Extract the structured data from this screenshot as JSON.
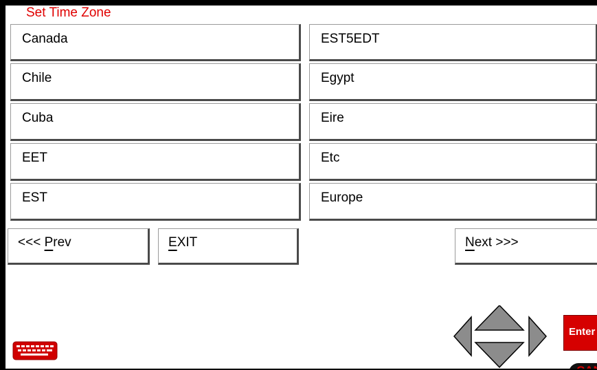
{
  "title": "Set Time Zone",
  "zones_left": [
    "Canada",
    "Chile",
    "Cuba",
    "EET",
    "EST"
  ],
  "zones_right": [
    "EST5EDT",
    "Egypt",
    "Eire",
    "Etc",
    "Europe"
  ],
  "nav": {
    "prev_prefix": "<<< ",
    "prev_hot": "P",
    "prev_rest": "rev",
    "exit_hot": "E",
    "exit_rest": "XIT",
    "next_hot": "N",
    "next_rest": "ext >>>"
  },
  "enter_label": "Enter",
  "cancel_label": "CAN",
  "colors": {
    "title": "#e00000",
    "enter_bg": "#d60000",
    "arrow_fill": "#8c8c8c"
  },
  "icons": [
    "keyboard-icon",
    "arrow-left-icon",
    "arrow-up-icon",
    "arrow-down-icon",
    "arrow-right-icon"
  ]
}
